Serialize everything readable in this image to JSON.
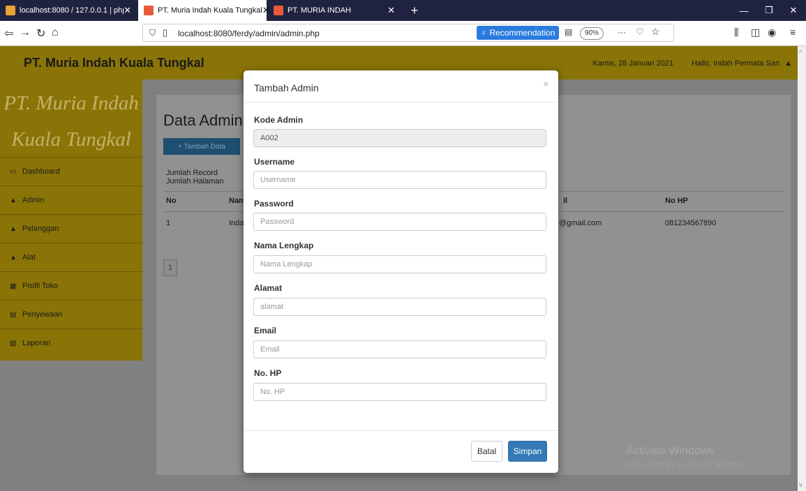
{
  "browser": {
    "tabs": [
      {
        "label": "localhost:8080 / 127.0.0.1 | php"
      },
      {
        "label": "PT. Muria Indah Kuala Tungkal"
      },
      {
        "label": "PT. MURIA INDAH"
      }
    ],
    "url": "localhost:8080/ferdy/admin/admin.php",
    "recommendation": "Recommendation",
    "zoom": "90%"
  },
  "header": {
    "brand": "PT. Muria Indah Kuala Tungkal",
    "date": "Kamis, 28 Januari 2021",
    "greeting": "Hallo, Indah Permata Sari"
  },
  "sidebar": {
    "logo_line1": "PT. Muria Indah",
    "logo_line2": "Kuala Tungkal",
    "items": [
      {
        "label": "Dashboard",
        "icon": "monitor-icon"
      },
      {
        "label": "Admin",
        "icon": "user-icon"
      },
      {
        "label": "Pelanggan",
        "icon": "users-icon"
      },
      {
        "label": "Alat",
        "icon": "users-icon"
      },
      {
        "label": "Profil Toko",
        "icon": "table-icon"
      },
      {
        "label": "Penyewaan",
        "icon": "calendar-icon"
      },
      {
        "label": "Laporan",
        "icon": "document-icon"
      }
    ]
  },
  "content": {
    "title": "Data Admin",
    "add_button": "+ Tambah Data",
    "record_label": "Jumlah Record",
    "page_label": "Jumlah Halaman",
    "columns": {
      "no": "No",
      "name": "Nam",
      "email": "il",
      "hp": "No HP"
    },
    "row": {
      "no": "1",
      "name": "Inda",
      "email": "@gmail.com",
      "hp": "081234567890"
    },
    "pager_page": "1"
  },
  "modal": {
    "title": "Tambah Admin",
    "close": "×",
    "fields": [
      {
        "label": "Kode Admin",
        "value": "A002",
        "placeholder": ""
      },
      {
        "label": "Username",
        "value": "",
        "placeholder": "Username"
      },
      {
        "label": "Password",
        "value": "",
        "placeholder": "Password"
      },
      {
        "label": "Nama Lengkap",
        "value": "",
        "placeholder": "Nama Lengkap"
      },
      {
        "label": "Alamat",
        "value": "",
        "placeholder": "alamat"
      },
      {
        "label": "Email",
        "value": "",
        "placeholder": "Email"
      },
      {
        "label": "No. HP",
        "value": "",
        "placeholder": "No. HP"
      }
    ],
    "cancel_button": "Batal",
    "save_button": "Simpan"
  },
  "watermark": {
    "title": "Activate Windows",
    "subtitle": "Go to Settings to activate Windows."
  }
}
